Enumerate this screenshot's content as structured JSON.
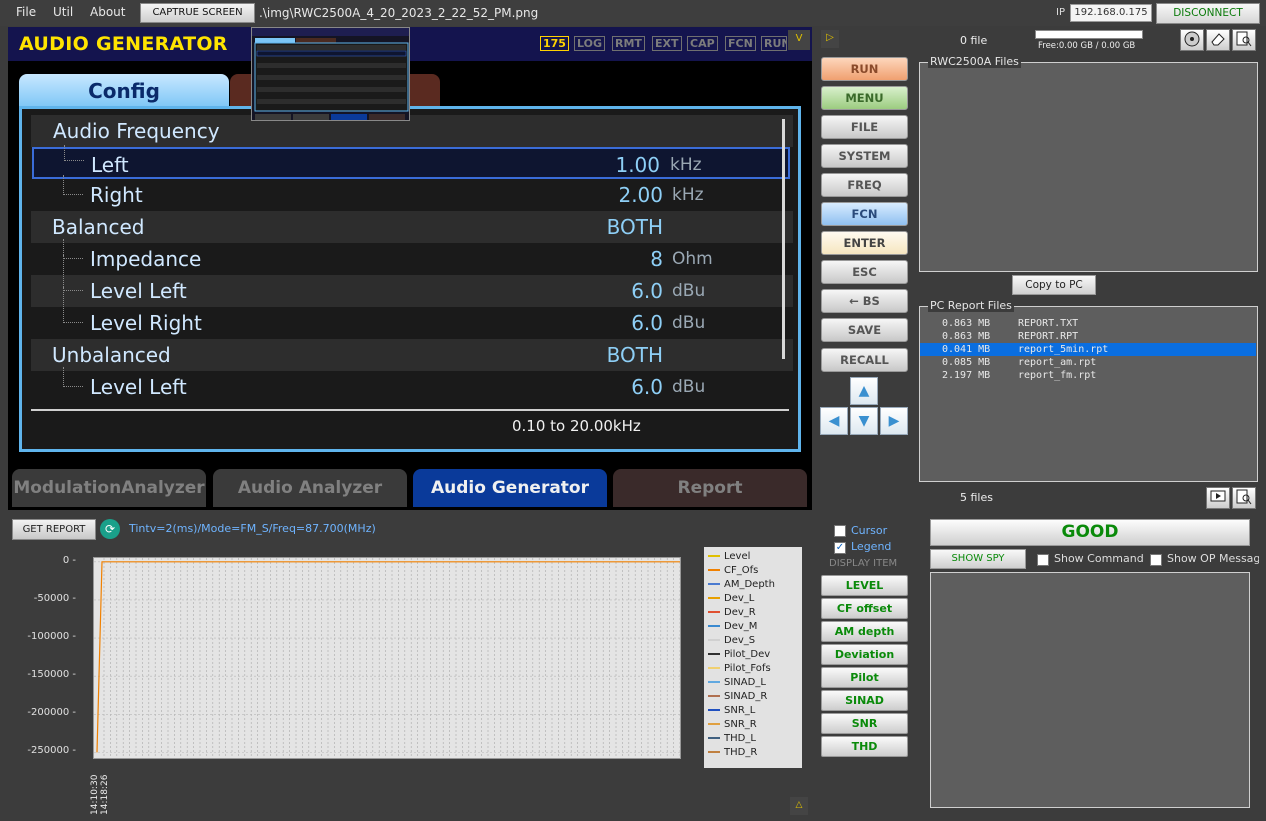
{
  "menu": {
    "items": [
      "File",
      "Util",
      "About"
    ],
    "capture_label": "CAPTRUE SCREEN",
    "image_path": ".\\img\\RWC2500A_4_20_2023_2_22_52_PM.png",
    "ip_label": "IP",
    "ip_value": "192.168.0.175",
    "disconnect_label": "DISCONNECT"
  },
  "device": {
    "title": "AUDIO GENERATOR",
    "badges": [
      "175",
      "LOG",
      "RMT",
      "EXT",
      "CAP",
      "FCN",
      "RUN"
    ],
    "corner_label": "V",
    "tab_active": "Config",
    "rows": [
      {
        "label": "Audio Frequency",
        "value": "",
        "unit": ""
      },
      {
        "label": "Left",
        "value": "1.00",
        "unit": "kHz"
      },
      {
        "label": "Right",
        "value": "2.00",
        "unit": "kHz"
      },
      {
        "label": "Balanced",
        "value": "BOTH",
        "unit": ""
      },
      {
        "label": "Impedance",
        "value": "8",
        "unit": "Ohm"
      },
      {
        "label": "Level Left",
        "value": "6.0",
        "unit": "dBu"
      },
      {
        "label": "Level Right",
        "value": "6.0",
        "unit": "dBu"
      },
      {
        "label": "Unbalanced",
        "value": "BOTH",
        "unit": ""
      },
      {
        "label": "Level Left",
        "value": "6.0",
        "unit": "dBu"
      }
    ],
    "range_text": "0.10  to  20.00kHz",
    "bottom_tabs": [
      "ModulationAnalyzer",
      "Audio  Analyzer",
      "Audio Generator",
      "Report"
    ]
  },
  "controls": {
    "play_icon": "▷",
    "buttons": [
      "RUN",
      "MENU",
      "FILE",
      "SYSTEM",
      "FREQ",
      "FCN",
      "ENTER",
      "ESC",
      "← BS",
      "SAVE",
      "RECALL"
    ],
    "arrows": [
      "▲",
      "◀",
      "▼",
      "▶"
    ]
  },
  "files": {
    "file_count": "0 file",
    "storage": "Free:0.00 GB / 0.00 GB",
    "rwc_title": "RWC2500A Files",
    "copy_label": "Copy to PC",
    "pc_title": "PC Report Files",
    "pc_files": [
      {
        "size": "0.863 MB",
        "name": "REPORT.TXT"
      },
      {
        "size": "0.863 MB",
        "name": "REPORT.RPT"
      },
      {
        "size": "0.041 MB",
        "name": "report_5min.rpt"
      },
      {
        "size": "0.085 MB",
        "name": "report_am.rpt"
      },
      {
        "size": "2.197 MB",
        "name": "report_fm.rpt"
      }
    ],
    "pc_count": "5 files"
  },
  "graph": {
    "get_report_label": "GET REPORT",
    "status": "Tintv=2(ms)/Mode=FM_S/Freq=87.700(MHz)",
    "x_ticks": [
      "14:10:30",
      "14:18:26"
    ],
    "legend": [
      {
        "name": "Level",
        "color": "#e0c000"
      },
      {
        "name": "CF_Ofs",
        "color": "#f08000"
      },
      {
        "name": "AM_Depth",
        "color": "#4a7ad0"
      },
      {
        "name": "Dev_L",
        "color": "#e8a000"
      },
      {
        "name": "Dev_R",
        "color": "#e05030"
      },
      {
        "name": "Dev_M",
        "color": "#3a8ad0"
      },
      {
        "name": "Dev_S",
        "color": "#d0d0d0"
      },
      {
        "name": "Pilot_Dev",
        "color": "#303030"
      },
      {
        "name": "Pilot_Fofs",
        "color": "#f0d070"
      },
      {
        "name": "SINAD_L",
        "color": "#60a8e0"
      },
      {
        "name": "SINAD_R",
        "color": "#b07050"
      },
      {
        "name": "SNR_L",
        "color": "#2050c0"
      },
      {
        "name": "SNR_R",
        "color": "#e0a040"
      },
      {
        "name": "THD_L",
        "color": "#406080"
      },
      {
        "name": "THD_R",
        "color": "#c08040"
      }
    ],
    "corner_label": "△"
  },
  "chart_data": {
    "type": "line",
    "x": [
      "14:10:30",
      "14:18:26"
    ],
    "series": [
      {
        "name": "Level",
        "values": [
          -250000,
          0
        ]
      }
    ],
    "yticks": [
      0,
      -50000,
      -100000,
      -150000,
      -200000,
      -250000
    ],
    "ylim": [
      -260000,
      5000
    ],
    "grid": true,
    "legend_position": "right"
  },
  "display": {
    "cursor_label": "Cursor",
    "legend_label": "Legend",
    "section_label": "DISPLAY ITEM",
    "items": [
      "LEVEL",
      "CF offset",
      "AM depth",
      "Deviation",
      "Pilot",
      "SINAD",
      "SNR",
      "THD"
    ]
  },
  "status_panel": {
    "good_label": "GOOD",
    "spy_label": "SHOW SPY",
    "show_command": "Show Command",
    "show_op": "Show OP Messag"
  }
}
